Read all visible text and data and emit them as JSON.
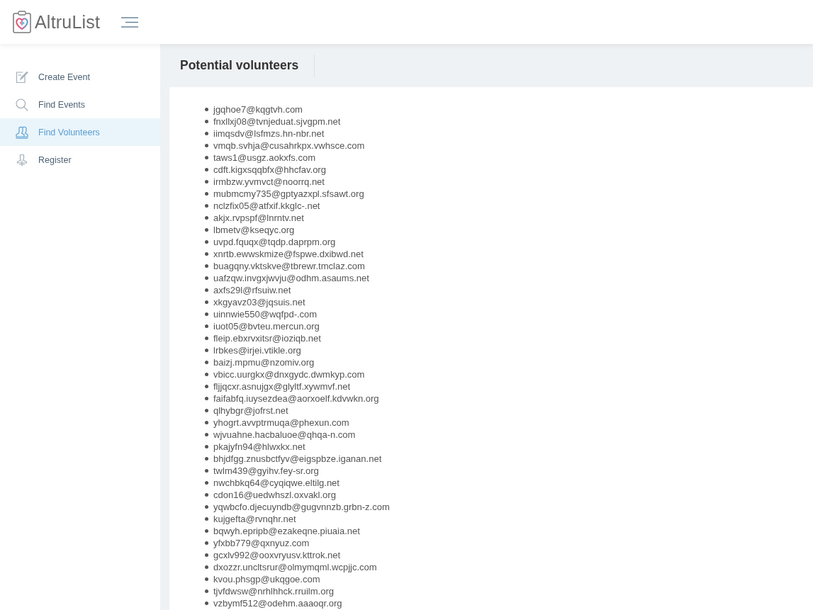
{
  "header": {
    "brand": "AltruList"
  },
  "sidebar": {
    "items": [
      {
        "label": "Create Event",
        "selected": false
      },
      {
        "label": "Find Events",
        "selected": false
      },
      {
        "label": "Find Volunteers",
        "selected": true
      },
      {
        "label": "Register",
        "selected": false
      }
    ]
  },
  "page": {
    "title": "Potential volunteers",
    "volunteers": [
      "jgqhoe7@kqgtvh.com",
      "fnxllxj08@tvnjeduat.sjvgpm.net",
      "iimqsdv@lsfmzs.hn-nbr.net",
      "vmqb.svhja@cusahrkpx.vwhsce.com",
      "taws1@usgz.aokxfs.com",
      "cdft.kigxsqqbfx@hhcfav.org",
      "irmbzw.yvmvct@noorrq.net",
      "mubmcmy735@gptyazxpl.sfsawt.org",
      "nclzfix05@atfxif.kkglc-.net",
      "akjx.rvpspf@lnrntv.net",
      "lbmetv@kseqyc.org",
      "uvpd.fquqx@tqdp.daprpm.org",
      "xnrtb.ewwskmize@fspwe.dxibwd.net",
      "buagqny.vktskve@tbrewr.tmclaz.com",
      "uafzqw.invgxjwvju@odhm.asaums.net",
      "axfs29l@rfsuiw.net",
      "xkgyavz03@jqsuis.net",
      "uinnwie550@wqfpd-.com",
      "iuot05@bvteu.mercun.org",
      "fleip.ebxrvxitsr@ioziqb.net",
      "lrbkes@irjei.vtikle.org",
      "baizj.mpmu@nzomiv.org",
      "vbicc.uurgkx@dnxgydc.dwmkyp.com",
      "fljjqcxr.asnujgx@glyltf.xywmvf.net",
      "faifabfq.iuysezdea@aorxoelf.kdvwkn.org",
      "qlhybgr@jofrst.net",
      "yhogrt.avvptrmuqa@phexun.com",
      "wjvuahne.hacbaluoe@qhqa-n.com",
      "pkajyfn94@hlwxkx.net",
      "bhjdfgg.znusbctfyv@eigspbze.iganan.net",
      "twlm439@gyihv.fey-sr.org",
      "nwchbkq64@cyqiqwe.eltilg.net",
      "cdon16@uedwhszl.oxvakl.org",
      "yqwbcfo.djecuyndb@gugvnnzb.grbn-z.com",
      "kujgefta@rvnqhr.net",
      "bqwyh.epripb@ezakeqne.piuaia.net",
      "yfxbb779@qxnyuz.com",
      "gcxlv992@ooxvryusv.kttrok.net",
      "dxozzr.uncltsrur@olmymqml.wcpjjc.com",
      "kvou.phsgp@ukqgoe.com",
      "tjvfdwsw@nrhlhhck.rruilm.org",
      "vzbymf512@odehm.aaaoqr.org"
    ]
  }
}
